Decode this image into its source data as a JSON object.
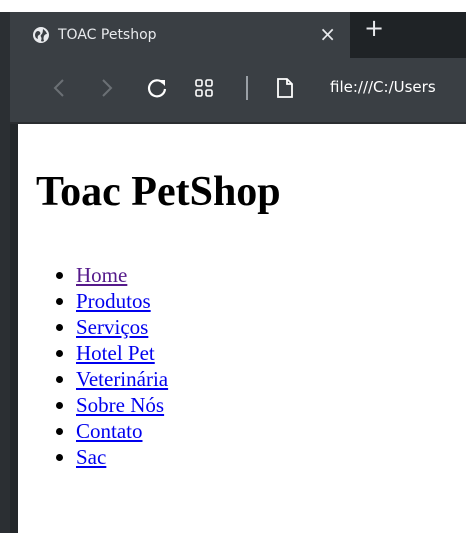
{
  "browser": {
    "tab_title": "TOAC Petshop",
    "tab_close_glyph": "×",
    "new_tab_glyph": "+",
    "address": "file:///C:/Users",
    "favicon_icon": "globe-icon",
    "colors": {
      "tabstrip": "#1f2326",
      "toolbar": "#3a3f44",
      "tab_text": "#e8eaed"
    }
  },
  "page": {
    "title": "Toac PetShop",
    "nav": [
      {
        "label": "Home",
        "visited": true
      },
      {
        "label": "Produtos",
        "visited": false
      },
      {
        "label": "Serviços",
        "visited": false
      },
      {
        "label": "Hotel Pet",
        "visited": false
      },
      {
        "label": "Veterinária",
        "visited": false
      },
      {
        "label": "Sobre Nós",
        "visited": false
      },
      {
        "label": "Contato",
        "visited": false
      },
      {
        "label": "Sac",
        "visited": false
      }
    ],
    "colors": {
      "link": "#0000ee",
      "visited_link": "#551a8b"
    }
  }
}
